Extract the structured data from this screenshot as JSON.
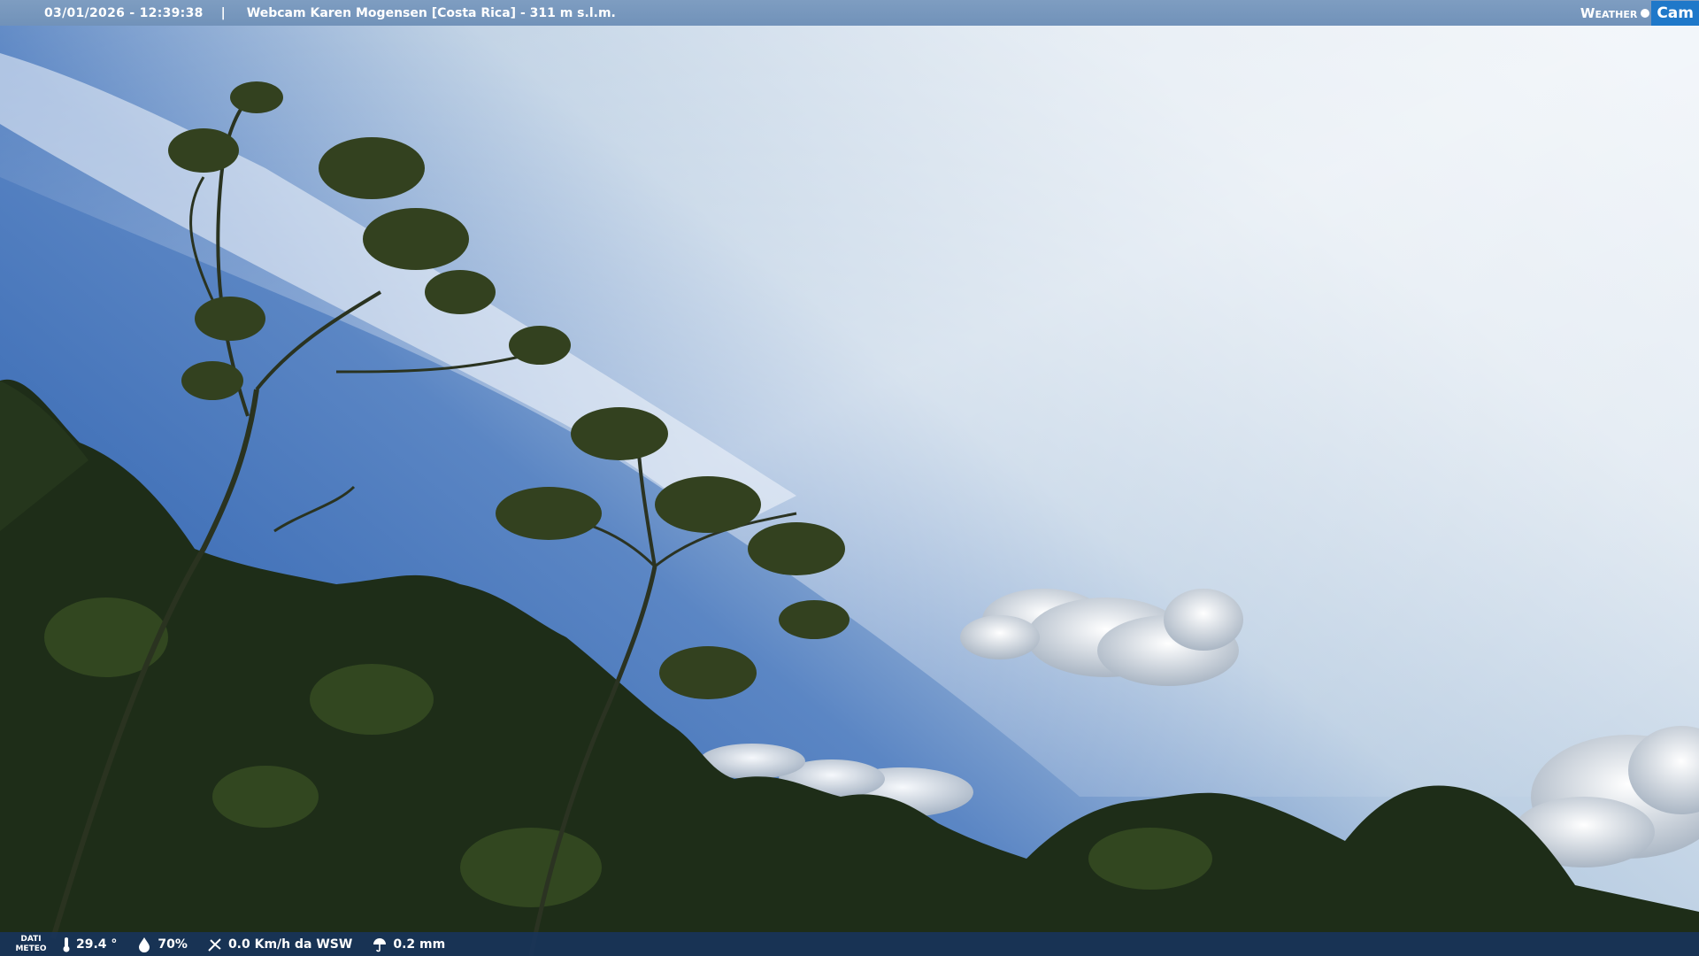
{
  "header": {
    "timestamp": "03/01/2026 - 12:39:38",
    "separator": "|",
    "title": "Webcam Karen Mogensen [Costa Rica] - 311 m s.l.m.",
    "logo_text_1": "Weather",
    "logo_text_2": "Cam"
  },
  "footer": {
    "label_line1": "DATI",
    "label_line2": "METEO",
    "temperature": "29.4 °",
    "humidity": "70%",
    "wind": "0.0 Km/h da WSW",
    "rain": "0.2 mm",
    "icons": [
      "thermometer-icon",
      "humidity-icon",
      "wind-icon",
      "rain-icon"
    ]
  },
  "colors": {
    "sky_deep": "#2f63b3",
    "sky_light": "#e6eef5",
    "foliage": "#1f2e1a",
    "logo_accent": "#1f78c9"
  }
}
